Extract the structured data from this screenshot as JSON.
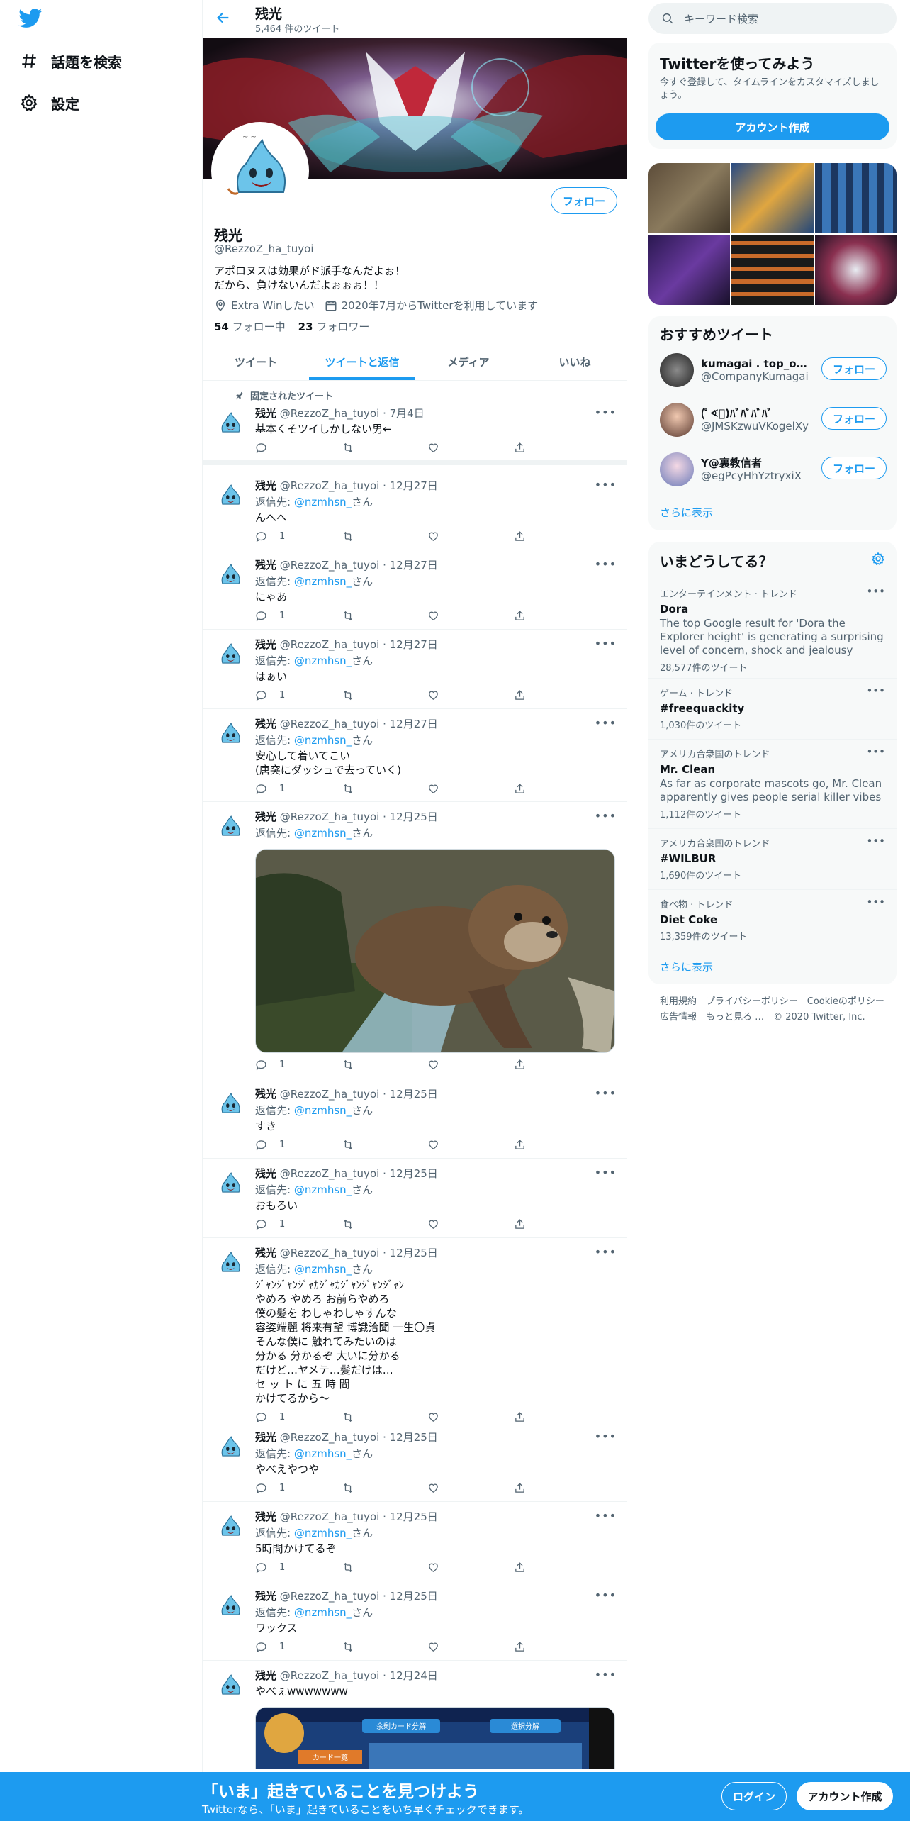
{
  "nav": {
    "items": [
      {
        "label": "話題を検索",
        "icon": "hashtag-icon"
      },
      {
        "label": "設定",
        "icon": "gear-icon"
      }
    ]
  },
  "header": {
    "name": "残光",
    "tweet_count": "5,464 件のツイート"
  },
  "profile": {
    "follow_label": "フォロー",
    "name": "残光",
    "handle": "@RezzoZ_ha_tuyoi",
    "bio_line1": "アポロヌスは効果がド派手なんだよぉ！",
    "bio_line2": "だから、負けないんだよぉぉぉ！！",
    "location": "Extra Winしたい",
    "joined": "2020年7月からTwitterを利用しています",
    "following_count": "54",
    "following_label": "フォロー中",
    "followers_count": "23",
    "followers_label": "フォロワー"
  },
  "tabs": [
    "ツイート",
    "ツイートと返信",
    "メディア",
    "いいね"
  ],
  "pinned_label": "固定されたツイート",
  "reply_prefix": "返信先:",
  "reply_suffix": "さん",
  "tweets": [
    {
      "name": "残光",
      "handle": "@RezzoZ_ha_tuyoi",
      "date": "7月4日",
      "reply_to": "",
      "text": "基本くそツイしかしない男←",
      "replies": ""
    },
    {
      "name": "残光",
      "handle": "@RezzoZ_ha_tuyoi",
      "date": "12月27日",
      "reply_to": "@nzmhsn_",
      "text": "んへへ",
      "replies": "1"
    },
    {
      "name": "残光",
      "handle": "@RezzoZ_ha_tuyoi",
      "date": "12月27日",
      "reply_to": "@nzmhsn_",
      "text": "にゃあ",
      "replies": "1"
    },
    {
      "name": "残光",
      "handle": "@RezzoZ_ha_tuyoi",
      "date": "12月27日",
      "reply_to": "@nzmhsn_",
      "text": "はぁい",
      "replies": "1"
    },
    {
      "name": "残光",
      "handle": "@RezzoZ_ha_tuyoi",
      "date": "12月27日",
      "reply_to": "@nzmhsn_",
      "text": "安心して着いてこい\n(唐突にダッシュで去っていく)",
      "replies": "1"
    },
    {
      "name": "残光",
      "handle": "@RezzoZ_ha_tuyoi",
      "date": "12月25日",
      "reply_to": "@nzmhsn_",
      "text": "",
      "replies": "1"
    },
    {
      "name": "残光",
      "handle": "@RezzoZ_ha_tuyoi",
      "date": "12月25日",
      "reply_to": "@nzmhsn_",
      "text": "すき",
      "replies": "1"
    },
    {
      "name": "残光",
      "handle": "@RezzoZ_ha_tuyoi",
      "date": "12月25日",
      "reply_to": "@nzmhsn_",
      "text": "おもろい",
      "replies": "1"
    },
    {
      "name": "残光",
      "handle": "@RezzoZ_ha_tuyoi",
      "date": "12月25日",
      "reply_to": "@nzmhsn_",
      "text": "ｼﾞｬﾝｼﾞｬﾝｼﾞｬｶｼﾞｬｶｼﾞｬﾝｼﾞｬﾝｼﾞｬﾝ\nやめろ やめろ お前らやめろ\n僕の髪を わしゃわしゃすんな\n容姿端麗 将来有望 博識洽聞 一生〇貞\nそんな僕に 触れてみたいのは\n分かる 分かるぞ 大いに分かる\nだけど…ヤメテ…髪だけは…\nセ ッ ト に 五 時 間\nかけてるから～",
      "replies": "1"
    },
    {
      "name": "残光",
      "handle": "@RezzoZ_ha_tuyoi",
      "date": "12月25日",
      "reply_to": "@nzmhsn_",
      "text": "やべえやつや",
      "replies": "1"
    },
    {
      "name": "残光",
      "handle": "@RezzoZ_ha_tuyoi",
      "date": "12月25日",
      "reply_to": "@nzmhsn_",
      "text": "5時間かけてるぞ",
      "replies": "1"
    },
    {
      "name": "残光",
      "handle": "@RezzoZ_ha_tuyoi",
      "date": "12月25日",
      "reply_to": "@nzmhsn_",
      "text": "ワックス",
      "replies": "1"
    },
    {
      "name": "残光",
      "handle": "@RezzoZ_ha_tuyoi",
      "date": "12月24日",
      "reply_to": "",
      "text": "やべぇwwwwwww",
      "replies": ""
    }
  ],
  "game_screen_texts": [
    "余剰カード分解",
    "選択分解",
    "カード一覧"
  ],
  "sidebar": {
    "search_placeholder": "キーワード検索",
    "signup_title": "Twitterを使ってみよう",
    "signup_desc": "今すぐ登録して、タイムラインをカスタマイズしましょう。",
    "signup_button": "アカウント作成",
    "rec_title": "おすすめツイート",
    "recs": [
      {
        "name": "kumagai . top_of_ザ...",
        "handle": "@CompanyKumagai"
      },
      {
        "name": "(ﾟ∢ﾟ)ﾊﾞﾊﾞﾊﾞﾊﾞ",
        "handle": "@JMSKzwuVKogelXy"
      },
      {
        "name": "Y@裏教信者",
        "handle": "@egPcyHhYztryxiX"
      }
    ],
    "rec_follow": "フォロー",
    "show_more": "さらに表示",
    "trends_title": "いまどうしてる？",
    "trends": [
      {
        "context": "エンターテインメント · トレンド",
        "topic": "Dora",
        "desc": "The top Google result for 'Dora the Explorer height' is generating a surprising level of concern, shock and jealousy",
        "count": "28,577件のツイート"
      },
      {
        "context": "ゲーム · トレンド",
        "topic": "#freequackity",
        "desc": "",
        "count": "1,030件のツイート"
      },
      {
        "context": "アメリカ合衆国のトレンド",
        "topic": "Mr. Clean",
        "desc": "As far as corporate mascots go, Mr. Clean apparently gives people serial killer vibes",
        "count": "1,112件のツイート"
      },
      {
        "context": "アメリカ合衆国のトレンド",
        "topic": "#WILBUR",
        "desc": "",
        "count": "1,690件のツイート"
      },
      {
        "context": "食べ物 · トレンド",
        "topic": "Diet Coke",
        "desc": "",
        "count": "13,359件のツイート"
      }
    ],
    "footer_line1": "利用規約　プライバシーポリシー　Cookieのポリシー",
    "footer_line2": "広告情報　もっと見る …　© 2020 Twitter, Inc."
  },
  "bottom": {
    "title": "「いま」起きていることを見つけよう",
    "subtitle": "Twitterなら、「いま」起きていることをいち早くチェックできます。",
    "login": "ログイン",
    "signup": "アカウント作成"
  },
  "colors": {
    "accent": "#1d9bf0",
    "text": "#0f1419",
    "muted": "#536471",
    "panel": "#f7f9f9"
  }
}
